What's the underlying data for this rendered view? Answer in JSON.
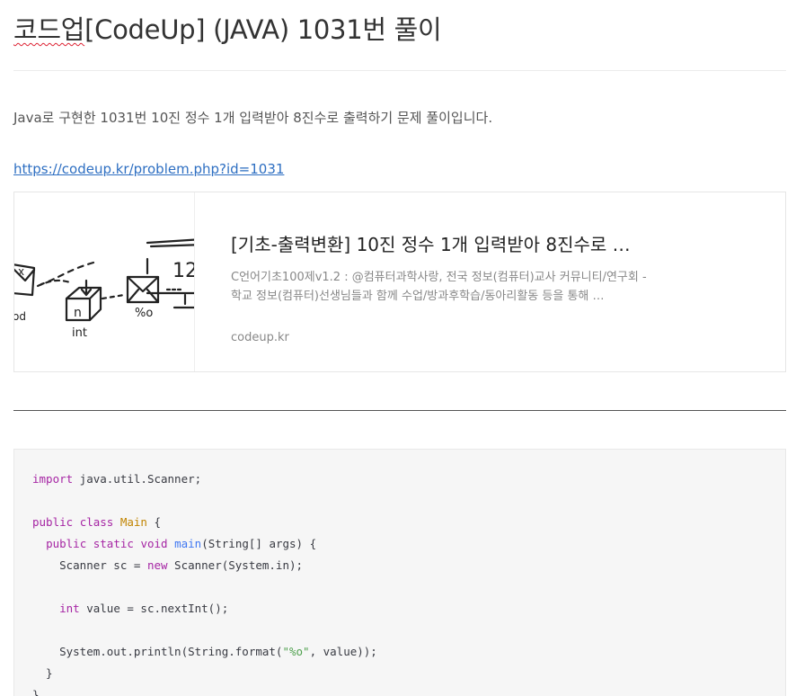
{
  "post": {
    "title_prefix": "코드업",
    "title_rest": "[CodeUp] (JAVA) 1031번 풀이",
    "intro": "Java로 구현한 1031번 10진 정수 1개 입력받아 8진수로 출력하기 문제 풀이입니다.",
    "link": "https://codeup.kr/problem.php?id=1031"
  },
  "card": {
    "title": "[기초-출력변환] 10진 정수 1개 입력받아 8진수로 …",
    "description": "C언어기초100제v1.2 : @컴퓨터과학사랑, 전국 정보(컴퓨터)교사 커뮤니티/연구회 - 학교 정보(컴퓨터)선생님들과 함께 수업/방과후학습/동아리활동 등을 통해 …",
    "domain": "codeup.kr",
    "thumb_labels": {
      "box": "n",
      "int_label": "int",
      "percent": "%o",
      "monitor_num": "12",
      "left_od": "od",
      "left_x": "x"
    }
  },
  "code": {
    "lines": [
      [
        {
          "t": "import",
          "c": "kw"
        },
        {
          "t": " java.util.Scanner;",
          "c": ""
        }
      ],
      [],
      [
        {
          "t": "public",
          "c": "kw"
        },
        {
          "t": " ",
          "c": ""
        },
        {
          "t": "class",
          "c": "kw"
        },
        {
          "t": " ",
          "c": ""
        },
        {
          "t": "Main",
          "c": "cls"
        },
        {
          "t": " {",
          "c": ""
        }
      ],
      [
        {
          "t": "  ",
          "c": ""
        },
        {
          "t": "public",
          "c": "kw"
        },
        {
          "t": " ",
          "c": ""
        },
        {
          "t": "static",
          "c": "kw"
        },
        {
          "t": " ",
          "c": ""
        },
        {
          "t": "void",
          "c": "kw"
        },
        {
          "t": " ",
          "c": ""
        },
        {
          "t": "main",
          "c": "fn"
        },
        {
          "t": "(String[] args) {",
          "c": ""
        }
      ],
      [
        {
          "t": "    Scanner sc = ",
          "c": ""
        },
        {
          "t": "new",
          "c": "kw"
        },
        {
          "t": " Scanner(System.in);",
          "c": ""
        }
      ],
      [],
      [
        {
          "t": "    ",
          "c": ""
        },
        {
          "t": "int",
          "c": "kw"
        },
        {
          "t": " value = sc.nextInt();",
          "c": ""
        }
      ],
      [],
      [
        {
          "t": "    System.out.println(String.format(",
          "c": ""
        },
        {
          "t": "\"%o\"",
          "c": "str"
        },
        {
          "t": ", value));",
          "c": ""
        }
      ],
      [
        {
          "t": "  }",
          "c": ""
        }
      ],
      [
        {
          "t": "}",
          "c": ""
        }
      ]
    ]
  },
  "colors": {
    "link": "#2e6fc2",
    "keyword": "#a626a4",
    "class_name": "#c18401",
    "function": "#4078f2",
    "string": "#50a14f",
    "code_bg": "#f6f6f6"
  }
}
